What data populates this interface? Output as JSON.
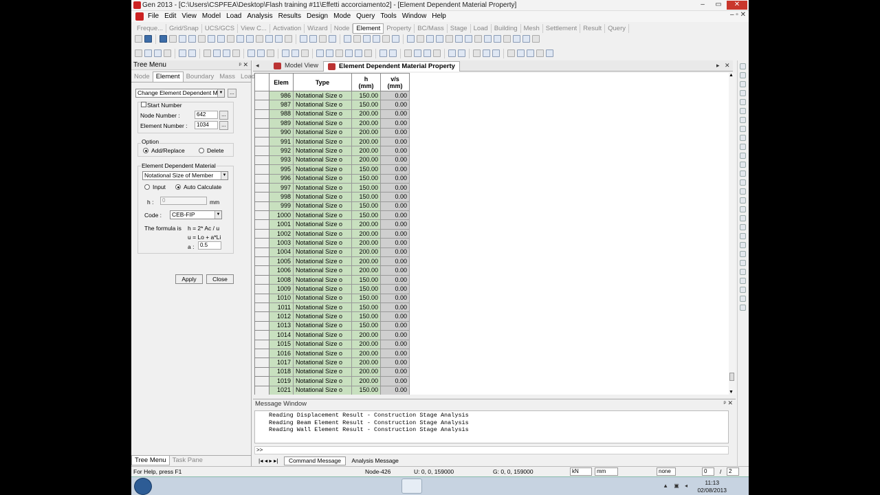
{
  "window": {
    "title": "Gen 2013 - [C:\\Users\\CSPFEA\\Desktop\\Flash training #11\\Effetti accorciamento2] - [Element Dependent Material Property]",
    "min": "–",
    "max": "▭",
    "close": "✕"
  },
  "menu": [
    "File",
    "Edit",
    "View",
    "Model",
    "Load",
    "Analysis",
    "Results",
    "Design",
    "Mode",
    "Query",
    "Tools",
    "Window",
    "Help"
  ],
  "mdi_controls": "–  ▫  ✕",
  "toolbar_tabs": [
    "Freque...",
    "Grid/Snap",
    "UCS/GCS",
    "View C...",
    "Activation",
    "Wizard",
    "Node",
    "Element",
    "Property",
    "BC/Mass",
    "Stage",
    "Load",
    "Building",
    "Mesh",
    "Settlement",
    "Result",
    "Query"
  ],
  "toolbar_tabs_active": "Element",
  "tree_menu": {
    "title": "Tree Menu",
    "pin": "ᵖ ✕",
    "tabs": [
      "Node",
      "Element",
      "Boundary",
      "Mass",
      "Load"
    ],
    "active_tab": "Element",
    "function_select": "Change Element Dependent Mater",
    "start_number_label": "Start Number",
    "node_number_label": "Node Number      :",
    "node_number": "642",
    "element_number_label": "Element Number  :",
    "element_number": "1034",
    "option_label": "Option",
    "add_replace": "Add/Replace",
    "delete": "Delete",
    "edm_label": "Element Dependent Material",
    "edm_select": "Notational Size of Member",
    "input_label": "Input",
    "auto_calc_label": "Auto Calculate",
    "h_label": "h :",
    "h_value": "0",
    "h_unit": "mm",
    "code_label": "Code :",
    "code_value": "CEB-FIP",
    "formula_label": "The formula is",
    "formula_1": "h = 2* Ac / u",
    "formula_2": "u = Lo + a*Li",
    "a_label": "a :",
    "a_value": "0.5",
    "apply": "Apply",
    "close": "Close",
    "bottom_tabs": [
      "Tree Menu",
      "Task Pane"
    ]
  },
  "doc_tabs": {
    "model_view": "Model View",
    "active": "Element Dependent Material Property",
    "prev": "◂",
    "next": "▸",
    "close": "✕",
    "left_nav": "◂"
  },
  "table": {
    "headers": [
      "Elem",
      "Type",
      "h\n(mm)",
      "v/s\n(mm)"
    ],
    "header_h": "h",
    "header_h_unit": "(mm)",
    "header_vs": "v/s",
    "header_vs_unit": "(mm)",
    "rows": [
      [
        "986",
        "Notational Size o",
        "150.00",
        "0.00"
      ],
      [
        "987",
        "Notational Size o",
        "150.00",
        "0.00"
      ],
      [
        "988",
        "Notational Size o",
        "200.00",
        "0.00"
      ],
      [
        "989",
        "Notational Size o",
        "200.00",
        "0.00"
      ],
      [
        "990",
        "Notational Size o",
        "200.00",
        "0.00"
      ],
      [
        "991",
        "Notational Size o",
        "200.00",
        "0.00"
      ],
      [
        "992",
        "Notational Size o",
        "200.00",
        "0.00"
      ],
      [
        "993",
        "Notational Size o",
        "200.00",
        "0.00"
      ],
      [
        "995",
        "Notational Size o",
        "150.00",
        "0.00"
      ],
      [
        "996",
        "Notational Size o",
        "150.00",
        "0.00"
      ],
      [
        "997",
        "Notational Size o",
        "150.00",
        "0.00"
      ],
      [
        "998",
        "Notational Size o",
        "150.00",
        "0.00"
      ],
      [
        "999",
        "Notational Size o",
        "150.00",
        "0.00"
      ],
      [
        "1000",
        "Notational Size o",
        "150.00",
        "0.00"
      ],
      [
        "1001",
        "Notational Size o",
        "200.00",
        "0.00"
      ],
      [
        "1002",
        "Notational Size o",
        "200.00",
        "0.00"
      ],
      [
        "1003",
        "Notational Size o",
        "200.00",
        "0.00"
      ],
      [
        "1004",
        "Notational Size o",
        "200.00",
        "0.00"
      ],
      [
        "1005",
        "Notational Size o",
        "200.00",
        "0.00"
      ],
      [
        "1006",
        "Notational Size o",
        "200.00",
        "0.00"
      ],
      [
        "1008",
        "Notational Size o",
        "150.00",
        "0.00"
      ],
      [
        "1009",
        "Notational Size o",
        "150.00",
        "0.00"
      ],
      [
        "1010",
        "Notational Size o",
        "150.00",
        "0.00"
      ],
      [
        "1011",
        "Notational Size o",
        "150.00",
        "0.00"
      ],
      [
        "1012",
        "Notational Size o",
        "150.00",
        "0.00"
      ],
      [
        "1013",
        "Notational Size o",
        "150.00",
        "0.00"
      ],
      [
        "1014",
        "Notational Size o",
        "200.00",
        "0.00"
      ],
      [
        "1015",
        "Notational Size o",
        "200.00",
        "0.00"
      ],
      [
        "1016",
        "Notational Size o",
        "200.00",
        "0.00"
      ],
      [
        "1017",
        "Notational Size o",
        "200.00",
        "0.00"
      ],
      [
        "1018",
        "Notational Size o",
        "200.00",
        "0.00"
      ],
      [
        "1019",
        "Notational Size o",
        "200.00",
        "0.00"
      ],
      [
        "1021",
        "Notational Size o",
        "150.00",
        "0.00"
      ]
    ],
    "colors": {
      "data_cell": "#c8e0bf",
      "readonly_cell": "#cfcfcf"
    }
  },
  "message_window": {
    "title": "Message Window",
    "controls": "ᵖ ✕",
    "lines": [
      "Reading Displacement Result - Construction Stage Analysis",
      "Reading Beam Element Result - Construction Stage Analysis",
      "Reading Wall Element Result - Construction Stage Analysis"
    ],
    "prompt": ">>",
    "tabs": [
      "Command Message",
      "Analysis Message"
    ]
  },
  "status": {
    "help": "For Help, press F1",
    "node": "Node-426",
    "u": "U: 0, 0, 159000",
    "g": "G: 0, 0, 159000",
    "force_unit": "kN",
    "length_unit": "mm",
    "filter": "none",
    "page_cur": "0",
    "page_sep": "/",
    "page_total": "2"
  },
  "taskbar": {
    "time": "11:13",
    "date": "02/08/2013"
  }
}
